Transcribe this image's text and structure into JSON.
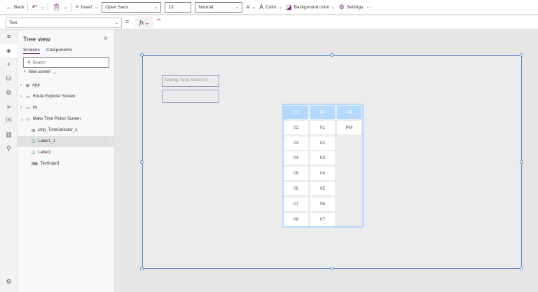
{
  "toolbar": {
    "back": "Back",
    "insert": "Insert",
    "font": "Open Sans",
    "size": "13",
    "weight": "Normal",
    "color": "Color",
    "bg_color": "Background color",
    "settings": "Settings",
    "more": "···"
  },
  "formula": {
    "property": "Text",
    "fx": "fx",
    "value": "\"\""
  },
  "tree": {
    "title": "Tree view",
    "tabs": [
      "Screens",
      "Components"
    ],
    "search_placeholder": "Search",
    "new_screen": "New screen",
    "nodes": [
      {
        "label": "App"
      },
      {
        "label": "Route Explorer Screen"
      },
      {
        "label": "tm"
      },
      {
        "label": "Make Time Picker Screen"
      },
      {
        "label": "cmp_TimeSelector_1"
      },
      {
        "label": "Label1_1"
      },
      {
        "label": "Label1"
      },
      {
        "label": "TextInput1"
      }
    ],
    "more": "···"
  },
  "canvas": {
    "label_text": "Testing Time Selector",
    "input_value": "",
    "hours": [
      "01",
      "02",
      "03",
      "04",
      "05",
      "06",
      "07",
      "08"
    ],
    "minutes": [
      "00",
      "01",
      "02",
      "03",
      "04",
      "05",
      "06",
      "07"
    ],
    "ampm": [
      "AM",
      "PM"
    ],
    "selected_color": "#b3d9ff"
  }
}
